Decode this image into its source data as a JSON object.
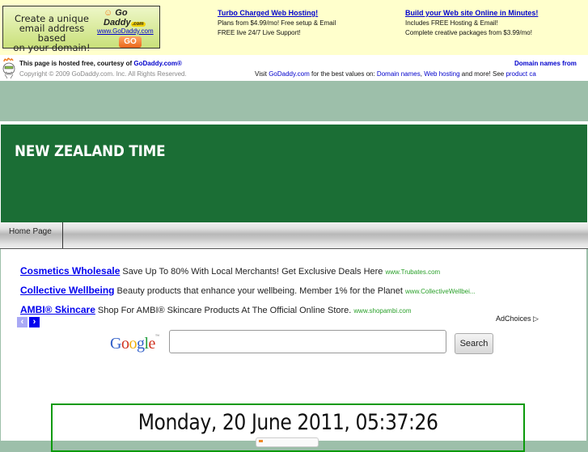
{
  "topbar": {
    "image_ad": {
      "text_lines": [
        "Create a unique",
        "email address based",
        "on your domain!"
      ],
      "logo": "Go Daddy",
      "logo_com": ".com",
      "url": "www.GoDaddy.com",
      "button": "GO"
    },
    "text_ads": [
      {
        "title": "Turbo Charged Web Hosting!",
        "line1": "Plans from $4.99/mo! Free setup & Email",
        "line2": "FREE live 24/7 Live Support!"
      },
      {
        "title": "Build your Web site Online in Minutes!",
        "line1": "Includes FREE Hosting & Email!",
        "line2": "Complete creative packages from $3.99/mo!"
      }
    ]
  },
  "hosted": {
    "line1_prefix": "This page is hosted free, courtesy of ",
    "line1_link": "GoDaddy.com®",
    "copyright": "Copyright © 2009 GoDaddy.com. Inc. All Rights Reserved.",
    "right_link": "Domain names from",
    "visit_prefix": "Visit ",
    "visit_link": "GoDaddy.com",
    "visit_mid": " for the best values on: ",
    "domain_link": "Domain names",
    "comma": ", ",
    "hosting_link": "Web hosting",
    "visit_suffix": " and more! See ",
    "product_link": "product ca"
  },
  "header": {
    "title": "NEW ZEALAND TIME"
  },
  "nav": {
    "items": [
      {
        "label": "Home Page"
      }
    ]
  },
  "ads": [
    {
      "title": "Cosmetics Wholesale",
      "text": " Save Up To 80% With Local Merchants! Get Exclusive Deals Here ",
      "url": "www.Trubates.com"
    },
    {
      "title": "Collective Wellbeing",
      "text": " Beauty products that enhance your wellbeing. Member 1% for the Planet ",
      "url": "www.CollectiveWellbei..."
    },
    {
      "title": "AMBI® Skincare",
      "text": " Shop For AMBI® Skincare Products At The Official Online Store. ",
      "url": "www.shopambi.com"
    }
  ],
  "pager": {
    "prev": "‹",
    "next": "›"
  },
  "adchoices": "AdChoices ▷",
  "search": {
    "logo_letters": [
      "G",
      "o",
      "o",
      "g",
      "l",
      "e"
    ],
    "logo_colors": [
      "#3361c9",
      "#d0311f",
      "#f2b10c",
      "#3361c9",
      "#1e9c3a",
      "#d0311f"
    ],
    "tm": "™",
    "value": "",
    "button": "Search"
  },
  "clock": {
    "datetime": "Monday, 20 June 2011, 05:37:26"
  },
  "colors": {
    "header_green": "#1b6e35",
    "sage": "#9dbfaa",
    "clock_border": "#0a9a0a",
    "ad_link": "#0000ee",
    "ad_url": "#2aa02a"
  }
}
